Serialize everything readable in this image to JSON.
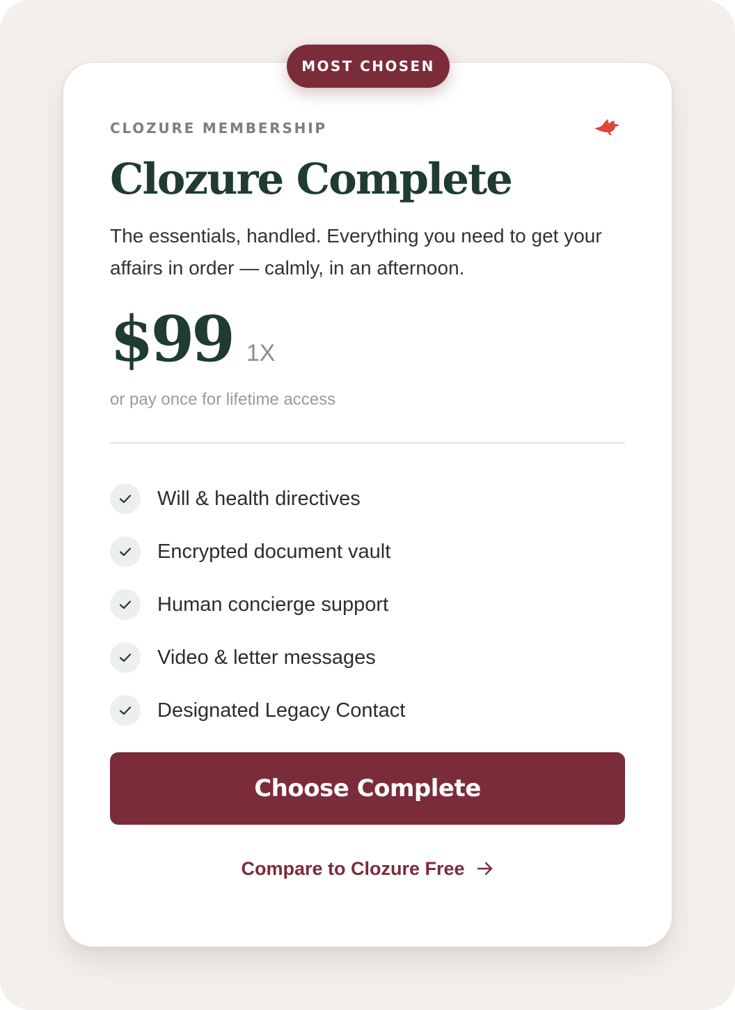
{
  "plan": {
    "badge": "MOST CHOSEN",
    "eyebrow": "CLOZURE MEMBERSHIP",
    "brand_icon": "bird-icon",
    "title": "Clozure Complete",
    "description": "The essentials, handled. Everything you need to get your affairs in order — calmly, in an afternoon.",
    "price": "$99",
    "price_suffix": "1X",
    "price_note": "or pay once for lifetime access"
  },
  "features": [
    {
      "label": "Will & health directives",
      "icon": "check-icon"
    },
    {
      "label": "Encrypted document vault",
      "icon": "check-icon"
    },
    {
      "label": "Human concierge support",
      "icon": "check-icon"
    },
    {
      "label": "Video & letter messages",
      "icon": "check-icon"
    },
    {
      "label": "Designated Legacy Contact",
      "icon": "check-icon"
    }
  ],
  "actions": {
    "primary_label": "Choose Complete",
    "secondary_label": "Compare to Clozure Free",
    "secondary_icon": "arrow-right-icon"
  },
  "colors": {
    "page_background": "#f3efea",
    "accent": "#7b2c39",
    "heading": "#1f3b33",
    "brand_icon": "#e0443a"
  }
}
